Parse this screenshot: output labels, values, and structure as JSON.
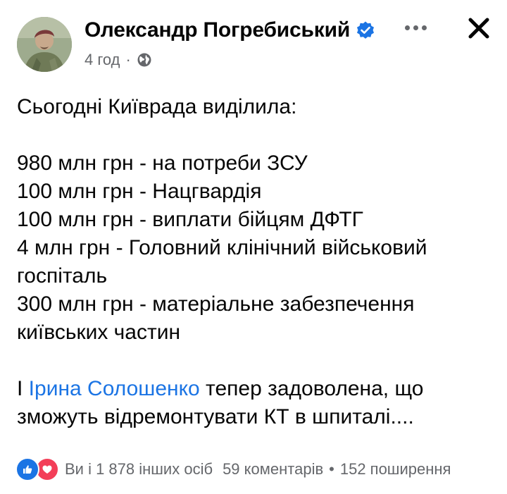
{
  "post": {
    "author": "Олександр Погребиський",
    "time": "4 год",
    "lines": [
      "Сьогодні Київрада виділила:",
      "",
      "980 млн грн - на потреби ЗСУ",
      "100 млн грн - Нацгвардія",
      "100 млн грн - виплати бійцям ДФТГ",
      "4 млн грн - Головний клінічний військовий",
      "госпіталь",
      "300 млн грн - матеріальне забезпечення",
      "київських частин",
      ""
    ],
    "closing": {
      "prefix": "І ",
      "mention": "Ірина Солошенко",
      "after_mention": " тепер задоволена, що",
      "line2": "зможуть відремонтувати КТ в шпиталі...."
    }
  },
  "footer": {
    "reactions_text": "Ви і 1 878 інших осіб",
    "comments": "59 коментарів",
    "separator": "•",
    "shares": "152 поширення"
  },
  "colors": {
    "accent": "#1b74e4",
    "secondary_text": "#65676b",
    "love": "#f33e58"
  },
  "icons": {
    "verified": "verified-badge-icon",
    "privacy": "globe-icon",
    "more": "more-dots-icon",
    "close": "close-icon",
    "like": "like-reaction-icon",
    "love": "love-reaction-icon"
  }
}
